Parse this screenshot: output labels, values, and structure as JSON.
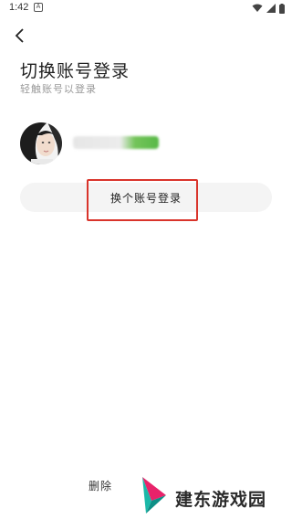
{
  "status_bar": {
    "time": "1:42",
    "notification_icon": "a-letter-icon"
  },
  "header": {
    "back_icon": "chevron-left-icon"
  },
  "page": {
    "title": "切换账号登录",
    "subtitle": "轻触账号以登录"
  },
  "account": {
    "avatar_icon": "avatar"
  },
  "switch_button": {
    "label": "换个账号登录"
  },
  "footer": {
    "delete_label": "删除"
  },
  "watermark": {
    "text": "建东游戏园"
  },
  "colors": {
    "highlight": "#d9342b",
    "button_bg": "#f4f4f4",
    "subtitle": "#999999"
  }
}
